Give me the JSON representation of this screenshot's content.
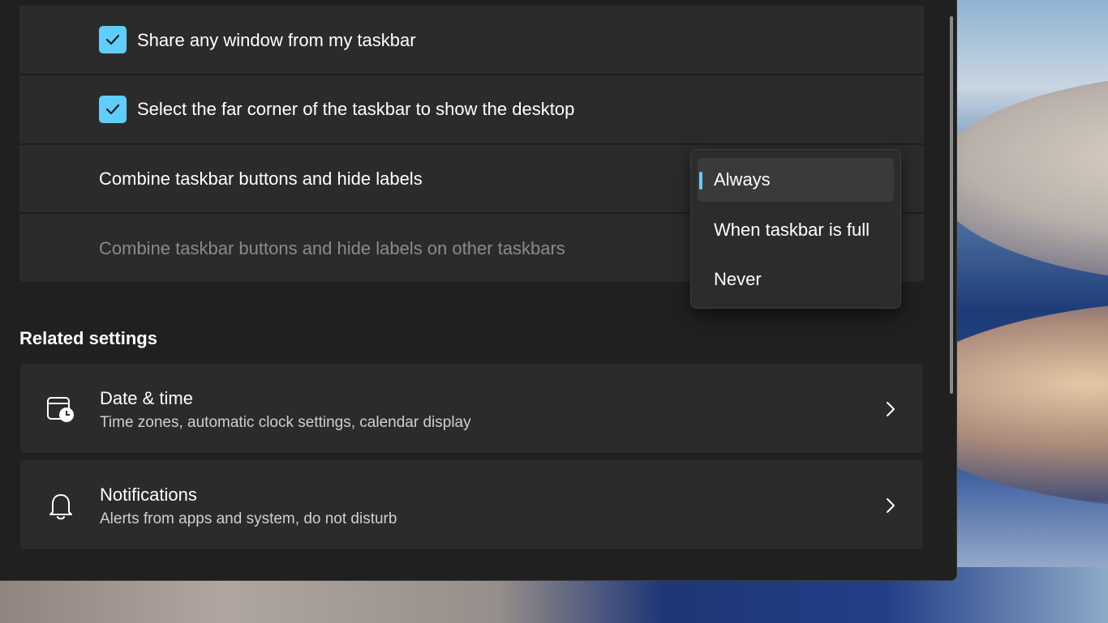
{
  "settings": {
    "share_window_label": "Share any window from my taskbar",
    "far_corner_label": "Select the far corner of the taskbar to show the desktop",
    "combine_label": "Combine taskbar buttons and hide labels",
    "combine_other_label": "Combine taskbar buttons and hide labels on other taskbars",
    "share_window_checked": true,
    "far_corner_checked": true
  },
  "dropdown": {
    "options": [
      {
        "label": "Always",
        "selected": true
      },
      {
        "label": "When taskbar is full",
        "selected": false
      },
      {
        "label": "Never",
        "selected": false
      }
    ]
  },
  "related": {
    "title": "Related settings",
    "items": [
      {
        "title": "Date & time",
        "subtitle": "Time zones, automatic clock settings, calendar display",
        "icon": "calendar-clock-icon"
      },
      {
        "title": "Notifications",
        "subtitle": "Alerts from apps and system, do not disturb",
        "icon": "bell-icon"
      }
    ]
  },
  "colors": {
    "accent": "#60cdff",
    "card_bg": "#2b2b2b",
    "window_bg": "#202020"
  }
}
